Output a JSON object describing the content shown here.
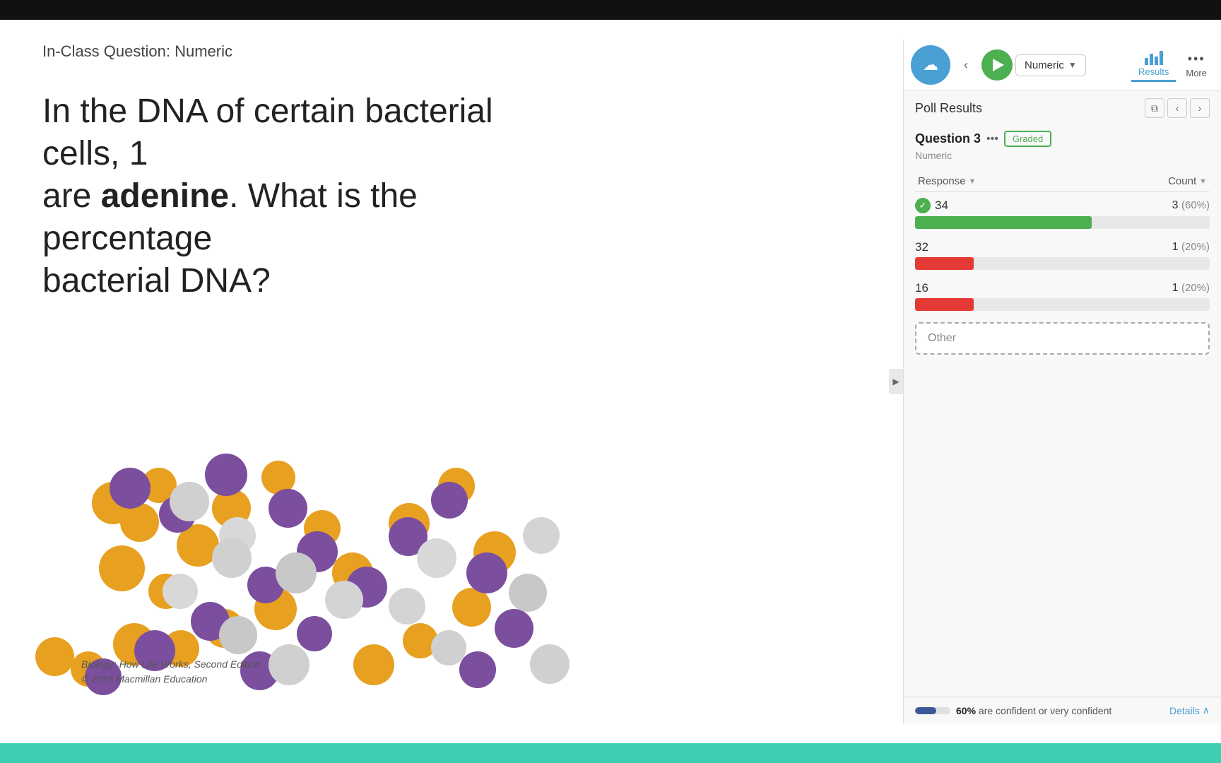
{
  "topBar": {
    "height": 28
  },
  "bottomBar": {
    "color": "#3ecfb2"
  },
  "slide": {
    "title": "In-Class Question: Numeric",
    "question": "In the DNA of certain bacterial cells, 1",
    "question2": "are adenine. What is the percentage",
    "question3": "bacterial DNA?",
    "citation_line1": "Biology: How Life Works, Second Edition",
    "citation_line2": "© 2016 Macmillan Education"
  },
  "toolbar": {
    "dropdown_label": "Numeric",
    "results_label": "Results",
    "more_label": "More"
  },
  "pollPanel": {
    "title": "Poll Results",
    "question_number": "Question 3",
    "question_type": "Numeric",
    "graded_badge": "Graded",
    "col_response": "Response",
    "col_count": "Count",
    "responses": [
      {
        "value": "34",
        "correct": true,
        "count": "3",
        "pct": "(60%)",
        "bar_pct": 60,
        "bar_color": "green"
      },
      {
        "value": "32",
        "correct": false,
        "count": "1",
        "pct": "(20%)",
        "bar_pct": 20,
        "bar_color": "red"
      },
      {
        "value": "16",
        "correct": false,
        "count": "1",
        "pct": "(20%)",
        "bar_pct": 20,
        "bar_color": "red"
      }
    ],
    "other_label": "Other",
    "confidence_pct": "60%",
    "confidence_text": "are confident or very confident",
    "details_label": "Details"
  }
}
